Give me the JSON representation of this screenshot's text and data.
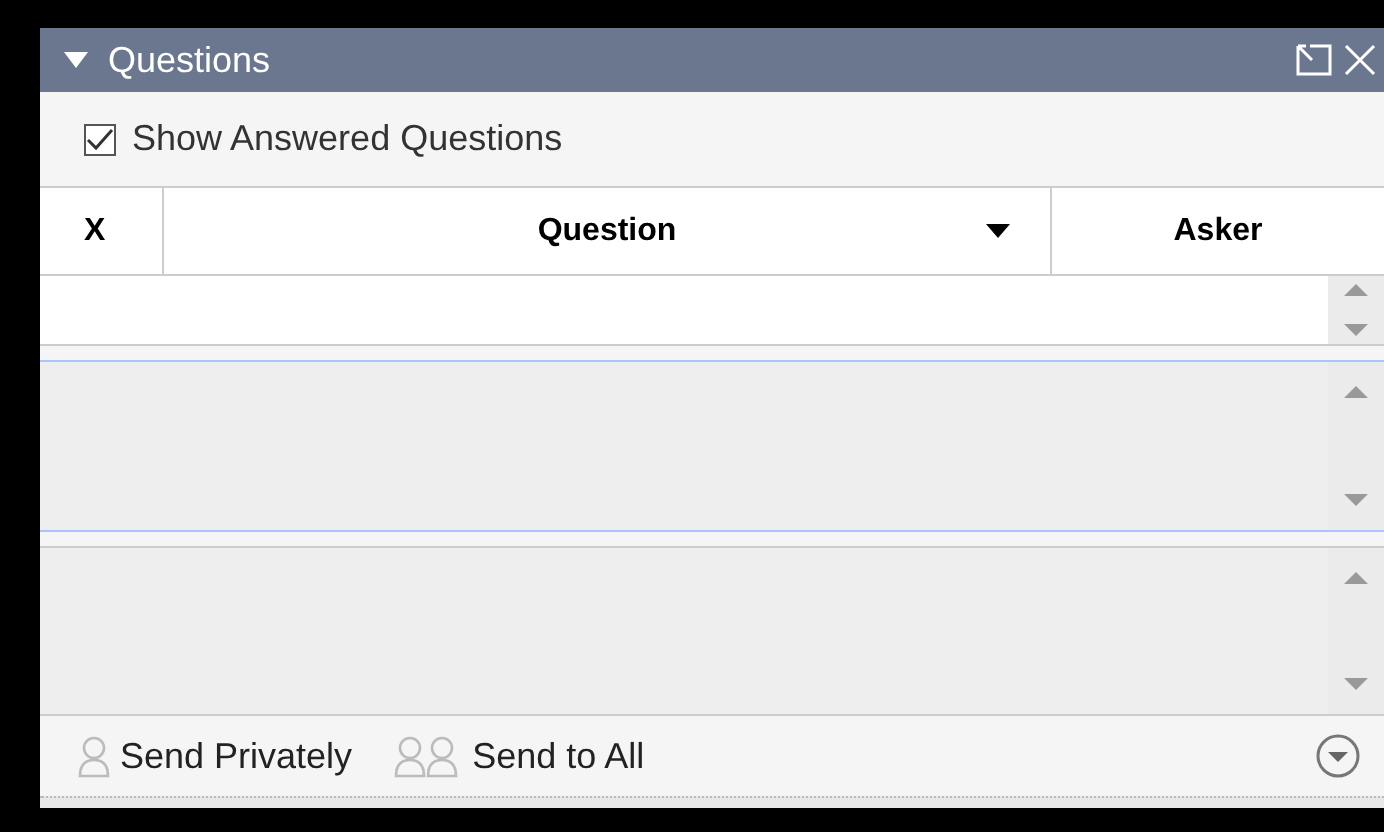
{
  "panel": {
    "title": "Questions"
  },
  "show_answered": {
    "label": "Show Answered Questions",
    "checked": true
  },
  "table": {
    "columns": [
      {
        "label": "X"
      },
      {
        "label": "Question",
        "sorted": true
      },
      {
        "label": "Asker"
      }
    ]
  },
  "footer": {
    "buttons": [
      {
        "label": "Send Privately",
        "kind": "single"
      },
      {
        "label": "Send to All",
        "kind": "group"
      }
    ]
  }
}
